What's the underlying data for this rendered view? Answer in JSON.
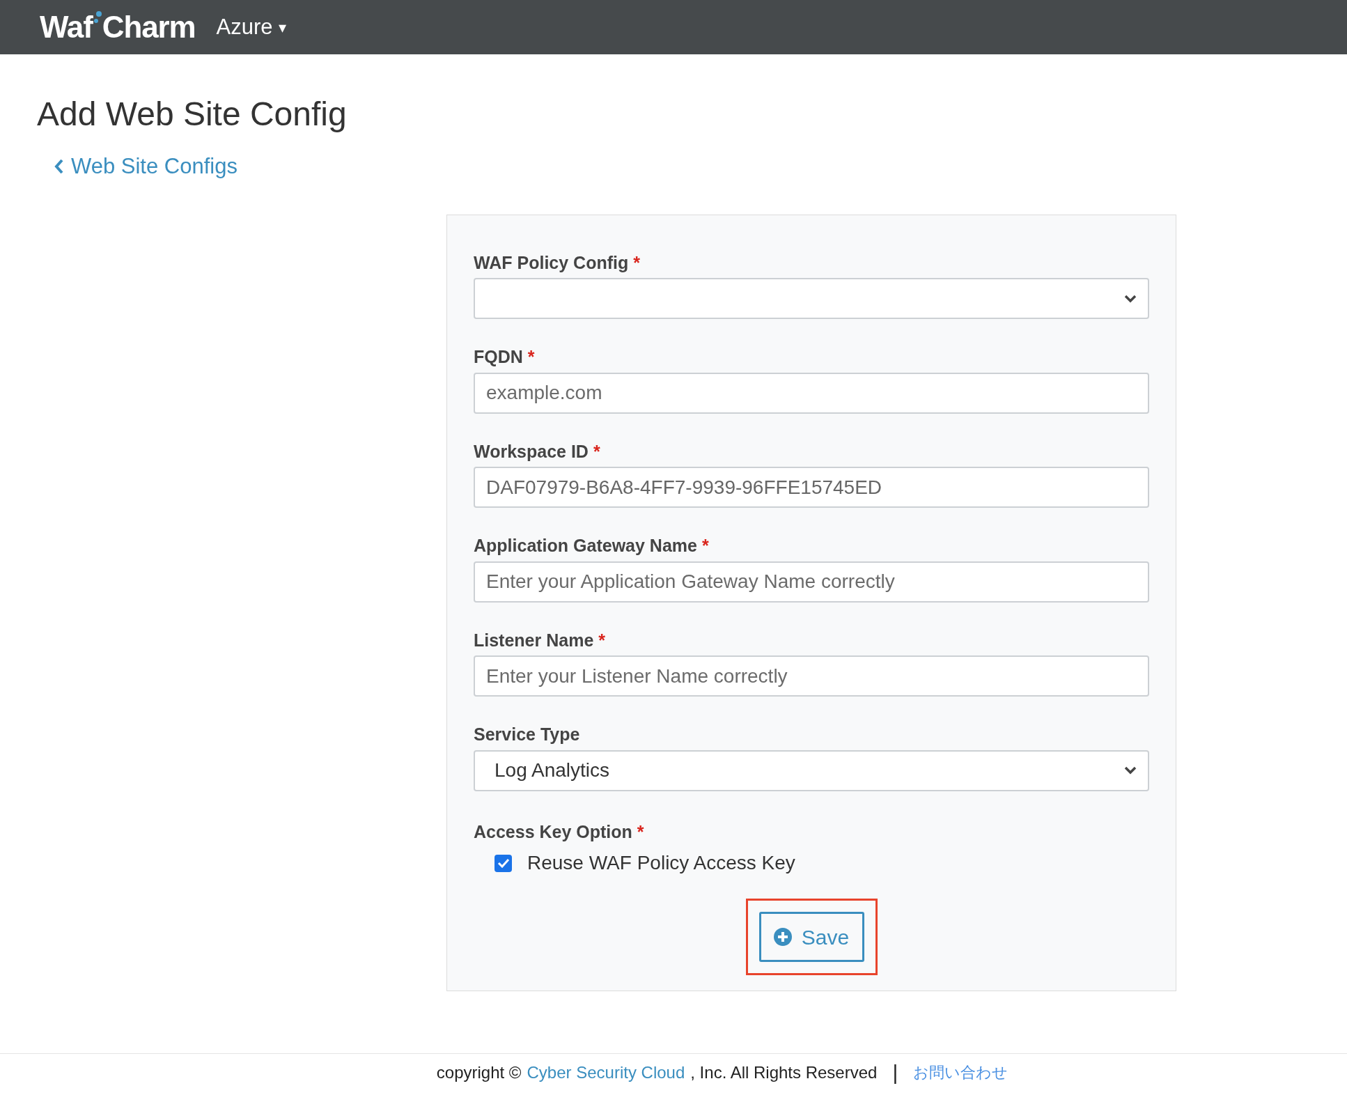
{
  "header": {
    "logo": [
      "Waf",
      "Charm"
    ],
    "menu": {
      "label": "Azure",
      "caret": "▾"
    }
  },
  "page": {
    "title": "Add Web Site Config",
    "back_link": "Web Site Configs"
  },
  "form": {
    "fields": [
      {
        "kind": "select",
        "label": "WAF Policy Config",
        "required_mark": "*"
      },
      {
        "kind": "text",
        "label": "FQDN",
        "required_mark": "*",
        "placeholder": "example.com"
      },
      {
        "kind": "text",
        "label": "Workspace ID",
        "required_mark": "*",
        "value": "DAF07979-B6A8-4FF7-9939-96FFE15745ED"
      },
      {
        "kind": "text",
        "label": "Application Gateway Name",
        "required_mark": "*",
        "placeholder": "Enter your Application Gateway Name correctly"
      },
      {
        "kind": "text",
        "label": "Listener Name",
        "required_mark": "*",
        "placeholder": "Enter your Listener Name correctly"
      },
      {
        "kind": "select",
        "label": "Service Type",
        "value": "Log Analytics"
      },
      {
        "kind": "checkbox",
        "label": "Access Key Option",
        "required_mark": "*",
        "option": "Reuse WAF Policy Access Key",
        "checked": true
      }
    ],
    "save_button": {
      "label": "Save",
      "highlighted": true
    }
  },
  "footer": {
    "copyright": "copyright ©",
    "company_link": "Cyber Security Cloud",
    "rights": ", Inc. All Rights Reserved",
    "separator": "|",
    "contact_link": "お問い合わせ"
  }
}
